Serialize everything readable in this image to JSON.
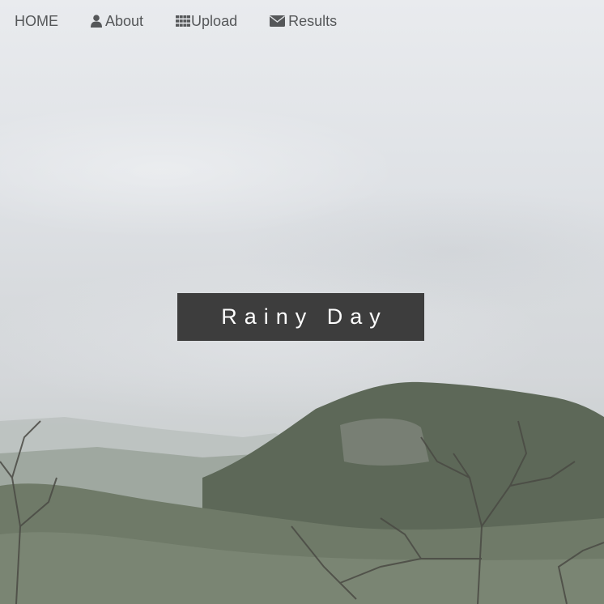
{
  "nav": {
    "items": [
      {
        "label": "HOME",
        "icon": null
      },
      {
        "label": "About",
        "icon": "user-icon"
      },
      {
        "label": "Upload",
        "icon": "grid-icon"
      },
      {
        "label": "Results",
        "icon": "envelope-icon"
      }
    ]
  },
  "hero": {
    "title": "Rainy Day"
  },
  "colors": {
    "nav_text": "#555759",
    "title_bg": "#3d3d3d",
    "title_text": "#ffffff",
    "sky": "#dfe2e6",
    "hills": "#5f6a5a"
  }
}
